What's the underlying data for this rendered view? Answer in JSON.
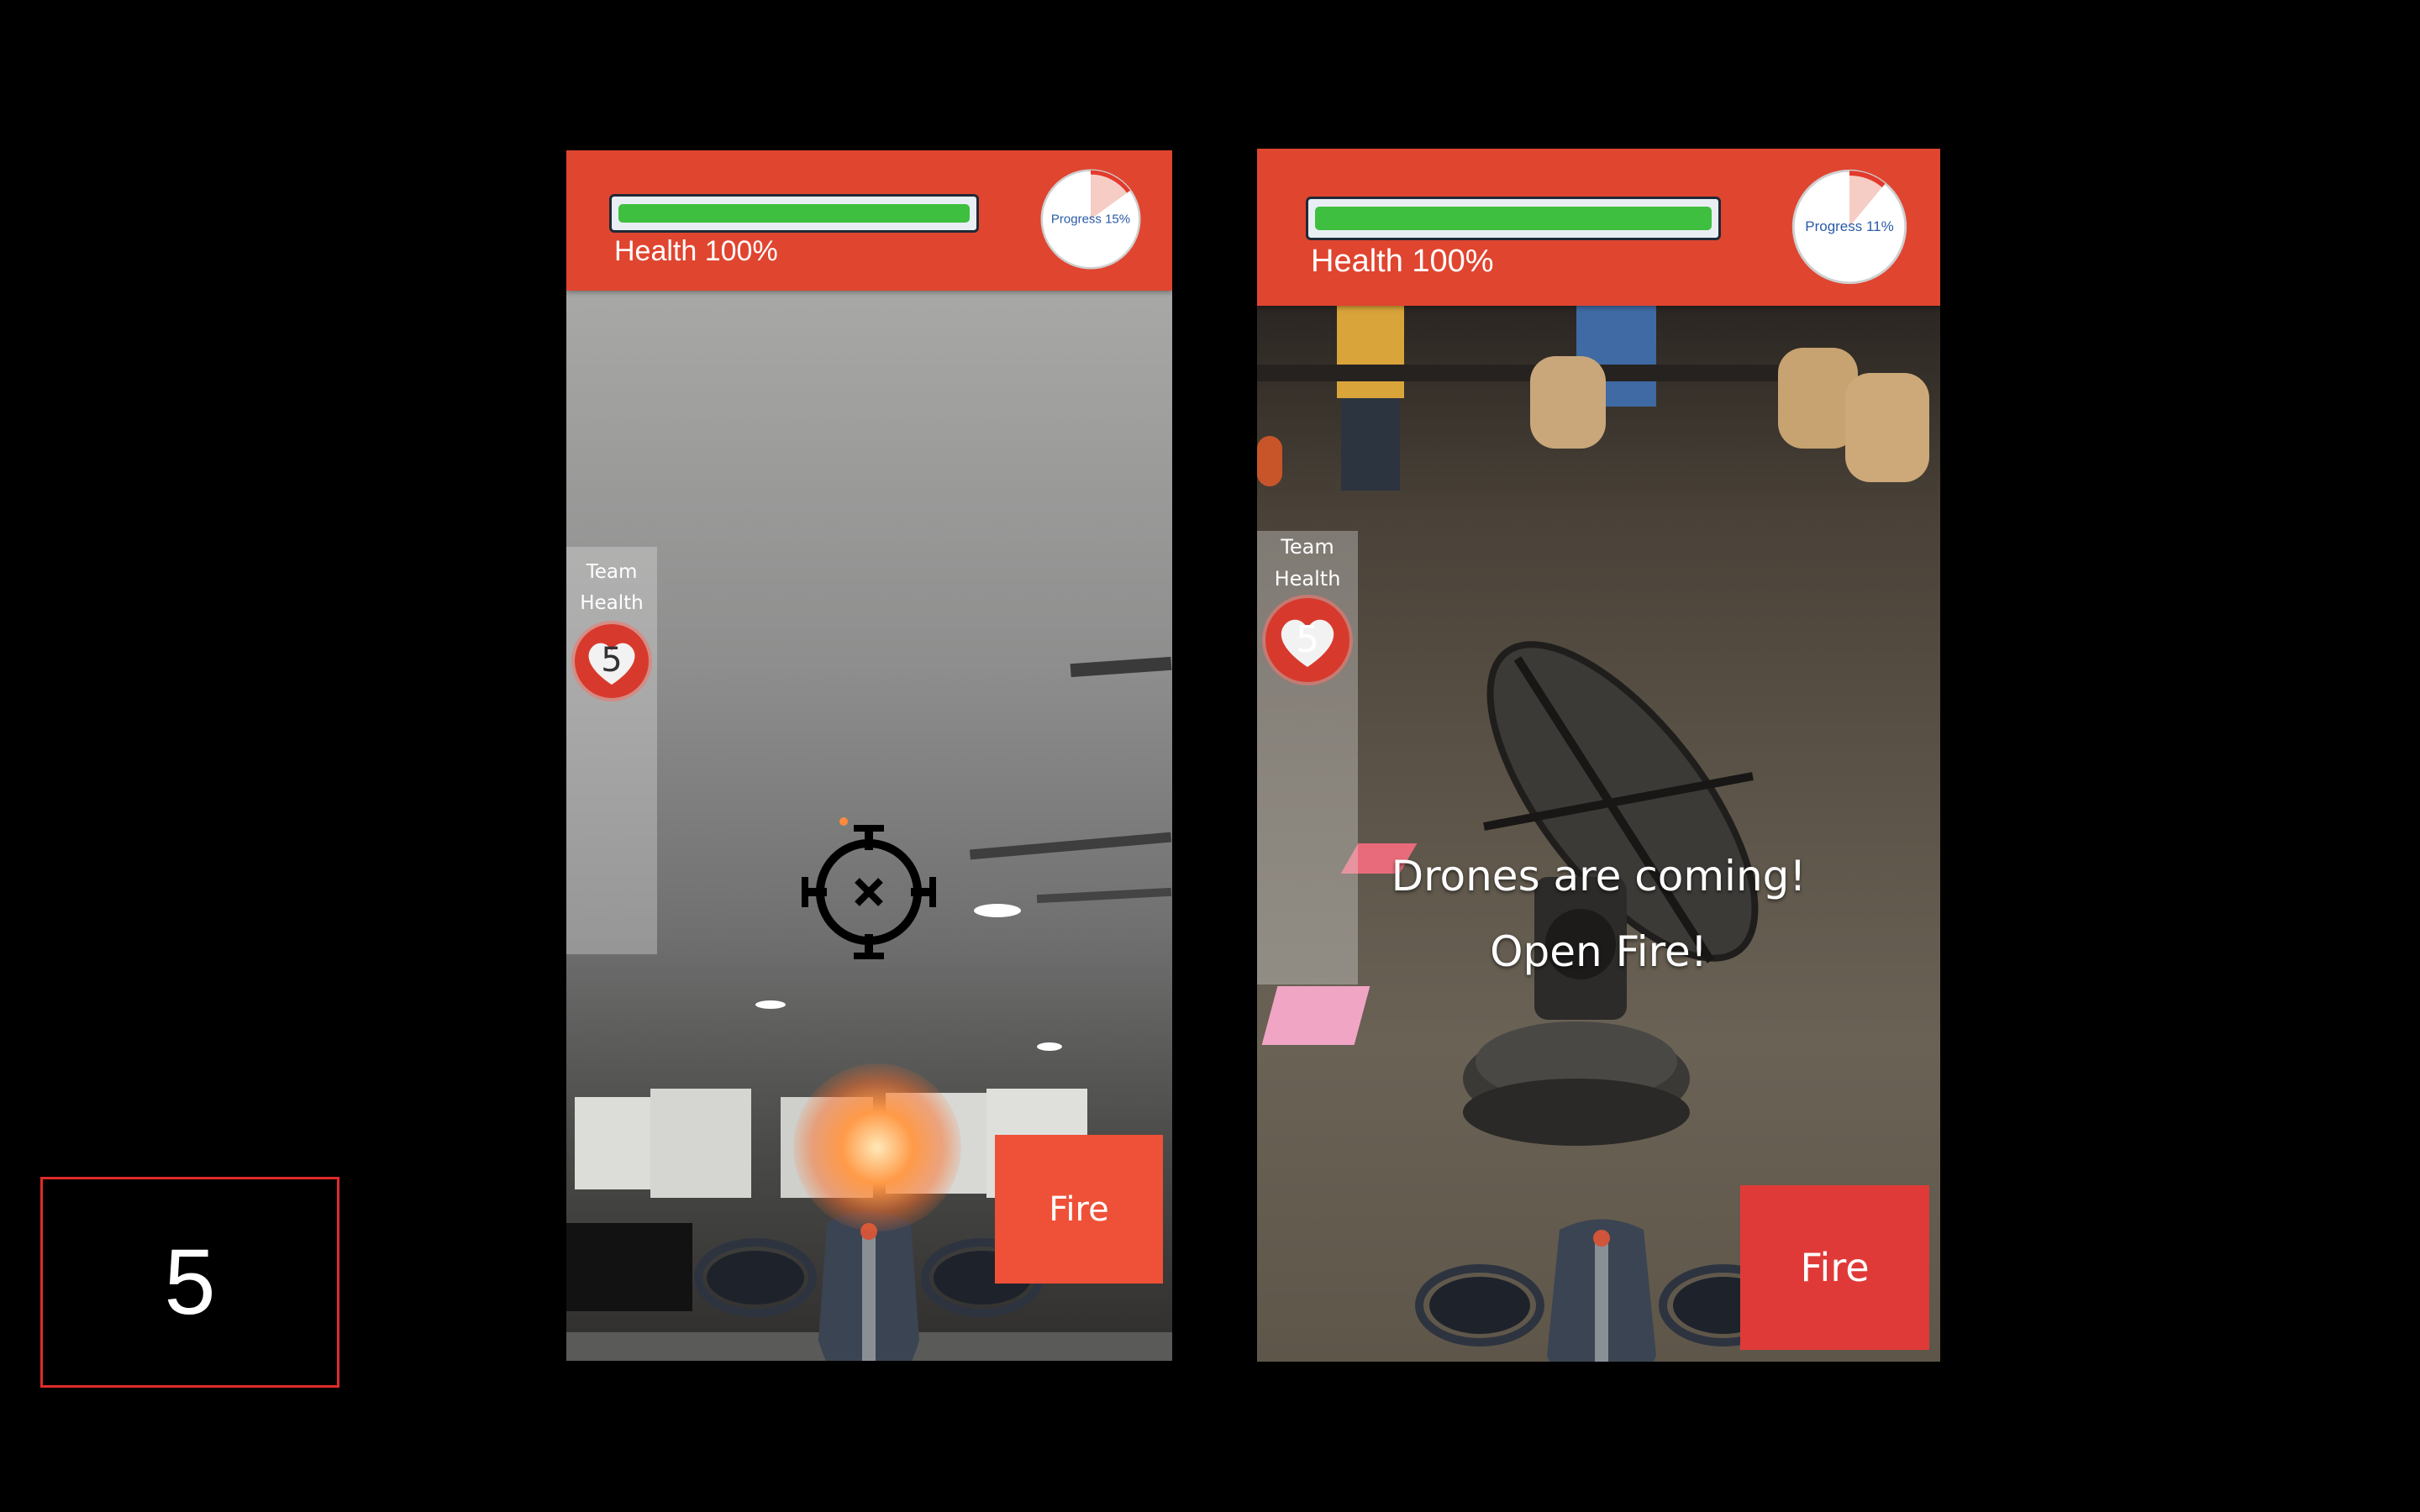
{
  "round_indicator": {
    "value": "5"
  },
  "left_phone": {
    "health": {
      "label": "Health 100%",
      "percent": 100
    },
    "progress": {
      "label": "Progress 15%",
      "percent": 15
    },
    "team_health": {
      "label_line1": "Team",
      "label_line2": "Health",
      "count": "5"
    },
    "fire_button": {
      "label": "Fire"
    }
  },
  "right_phone": {
    "health": {
      "label": "Health 100%",
      "percent": 100
    },
    "progress": {
      "label": "Progress 11%",
      "percent": 11
    },
    "team_health": {
      "label_line1": "Team",
      "label_line2": "Health",
      "count": "5"
    },
    "banner": {
      "line1": "Drones are coming!",
      "line2": "Open Fire!"
    },
    "fire_button": {
      "label": "Fire"
    }
  },
  "colors": {
    "hud_bar": "#e04530",
    "health_fill": "#3fbf3f",
    "progress_arc": "#e33a2c",
    "heart_badge": "#d73a2d",
    "fire_left": "#ee5137",
    "fire_right": "#e03a38",
    "round_border": "#e02a2a"
  }
}
